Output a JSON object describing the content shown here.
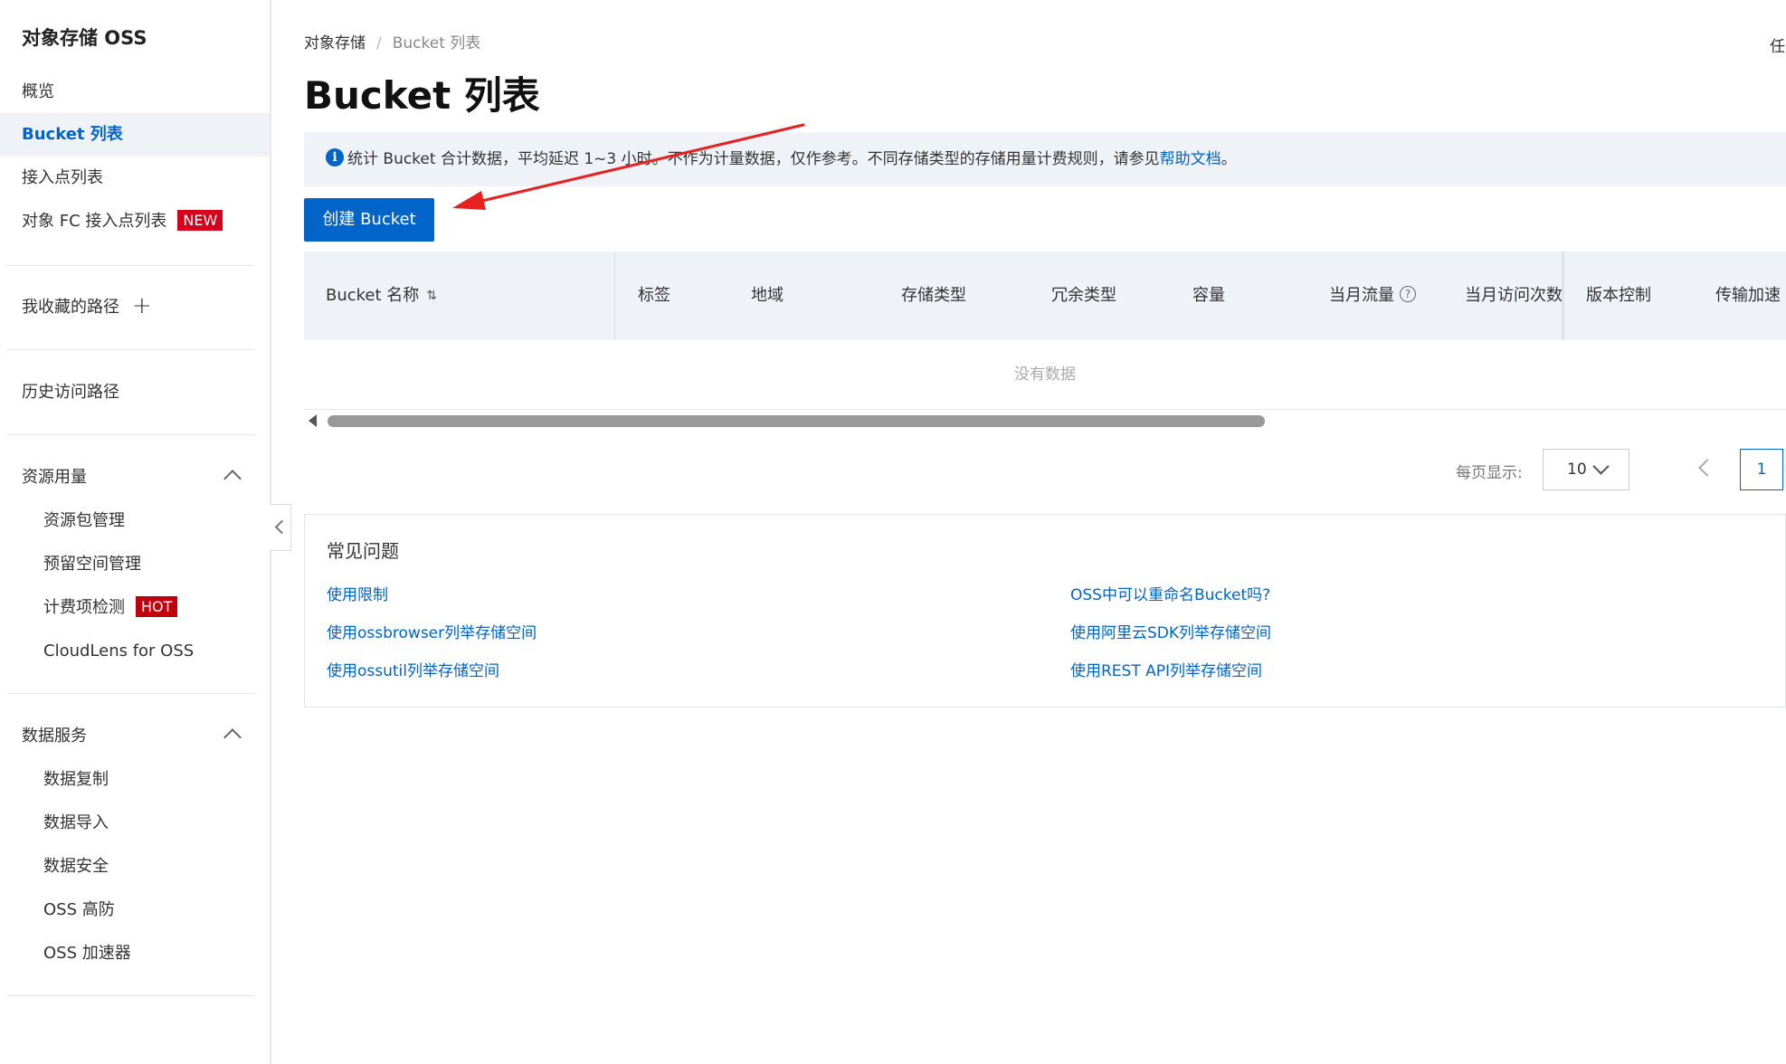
{
  "sidebar": {
    "title": "对象存储 OSS",
    "items": [
      {
        "label": "概览"
      },
      {
        "label": "Bucket 列表"
      },
      {
        "label": "接入点列表"
      },
      {
        "label": "对象 FC 接入点列表",
        "badge": "NEW"
      },
      {
        "label": "我收藏的路径",
        "action": "+"
      },
      {
        "label": "历史访问路径"
      },
      {
        "label": "资源用量"
      },
      {
        "label": "资源包管理"
      },
      {
        "label": "预留空间管理"
      },
      {
        "label": "计费项检测",
        "badge": "HOT"
      },
      {
        "label": "CloudLens for OSS"
      },
      {
        "label": "数据服务"
      },
      {
        "label": "数据复制"
      },
      {
        "label": "数据导入"
      },
      {
        "label": "数据安全"
      },
      {
        "label": "OSS 高防"
      },
      {
        "label": "OSS 加速器"
      }
    ]
  },
  "breadcrumb": {
    "root": "对象存储",
    "separator": "/",
    "current": "Bucket 列表"
  },
  "top_right_text": "任",
  "page_title": "Bucket 列表",
  "notice": {
    "text": "统计 Bucket 合计数据，平均延迟 1~3 小时。不作为计量数据，仅作参考。不同存储类型的存储用量计费规则，请参见",
    "link": "帮助文档",
    "suffix": "。"
  },
  "create_button": "创建 Bucket",
  "table": {
    "columns": [
      "Bucket 名称",
      "标签",
      "地域",
      "存储类型",
      "冗余类型",
      "容量",
      "当月流量",
      "当月访问次数",
      "版本控制",
      "传输加速"
    ],
    "empty_text": "没有数据"
  },
  "pagination": {
    "per_page_label": "每页显示:",
    "per_page_value": "10",
    "current_page": "1"
  },
  "faq": {
    "title": "常见问题",
    "links": [
      "使用限制",
      "OSS中可以重命名Bucket吗?",
      "使用ossbrowser列举存储空间",
      "使用阿里云SDK列举存储空间",
      "使用ossutil列举存储空间",
      "使用REST API列举存储空间"
    ]
  },
  "colors": {
    "accent": "#0064c8",
    "active_bg": "#eff3f8",
    "badge_red": "#d6001c",
    "annotation_arrow": "#e8201f"
  }
}
